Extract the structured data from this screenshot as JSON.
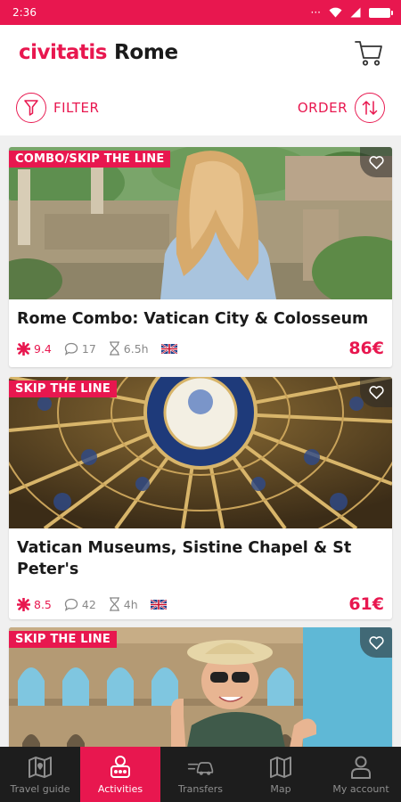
{
  "status_bar": {
    "time": "2:36",
    "dots": "···"
  },
  "header": {
    "logo": "civitatis",
    "city": "Rome"
  },
  "filter_bar": {
    "filter_label": "FILTER",
    "order_label": "ORDER"
  },
  "activities": [
    {
      "badge": "COMBO/SKIP THE LINE",
      "title": "Rome Combo: Vatican City & Colosseum",
      "rating": "9.4",
      "reviews": "17",
      "duration": "6.5h",
      "price": "86€"
    },
    {
      "badge": "SKIP THE LINE",
      "title": "Vatican Museums, Sistine Chapel & St Peter's",
      "rating": "8.5",
      "reviews": "42",
      "duration": "4h",
      "price": "61€"
    },
    {
      "badge": "SKIP THE LINE",
      "title": "",
      "rating": "",
      "reviews": "",
      "duration": "",
      "price": ""
    }
  ],
  "bottom_nav": {
    "items": [
      {
        "label": "Travel guide",
        "icon": "map-guide-icon"
      },
      {
        "label": "Activities",
        "icon": "activities-icon"
      },
      {
        "label": "Transfers",
        "icon": "transfers-icon"
      },
      {
        "label": "Map",
        "icon": "map-icon"
      },
      {
        "label": "My account",
        "icon": "account-icon"
      }
    ],
    "active_index": 1
  },
  "colors": {
    "brand": "#e8174f",
    "nav_background": "#1d1d1d",
    "nav_inactive": "#8e8e8e"
  }
}
